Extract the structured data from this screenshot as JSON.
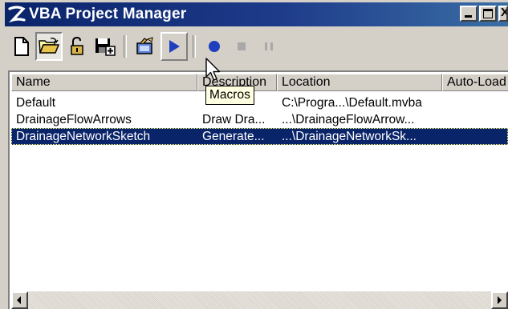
{
  "window": {
    "title": "VBA Project Manager"
  },
  "toolbar": {
    "buttons": [
      {
        "name": "new-project",
        "icon": "new-document-icon"
      },
      {
        "name": "load-project",
        "icon": "open-folder-icon",
        "state": "pressed"
      },
      {
        "name": "unload-project",
        "icon": "unlock-icon"
      },
      {
        "name": "save-as",
        "icon": "save-as-icon"
      },
      {
        "name": "vba-editor",
        "icon": "editor-icon"
      },
      {
        "name": "macros",
        "icon": "play-icon",
        "state": "hover"
      },
      {
        "name": "record",
        "icon": "record-icon"
      },
      {
        "name": "stop",
        "icon": "stop-icon"
      },
      {
        "name": "pause",
        "icon": "pause-icon"
      }
    ]
  },
  "tooltip": {
    "text": "Macros"
  },
  "list": {
    "columns": [
      "Name",
      "Description",
      "Location",
      "Auto-Load"
    ],
    "rows": [
      {
        "name": "Default",
        "description": "",
        "location": "C:\\Progra...\\Default.mvba",
        "autoload": "",
        "selected": false
      },
      {
        "name": "DrainageFlowArrows",
        "description": "Draw Dra...",
        "location": "...\\DrainageFlowArrow...",
        "autoload": "",
        "selected": false
      },
      {
        "name": "DrainageNetworkSketch",
        "description": "Generate...",
        "location": "...\\DrainageNetworkSk...",
        "autoload": "",
        "selected": true
      }
    ]
  },
  "colors": {
    "titlebar": "#0a246a",
    "selection": "#0a246a",
    "play_blue": "#1f3fbf",
    "face": "#d4d0c8"
  }
}
